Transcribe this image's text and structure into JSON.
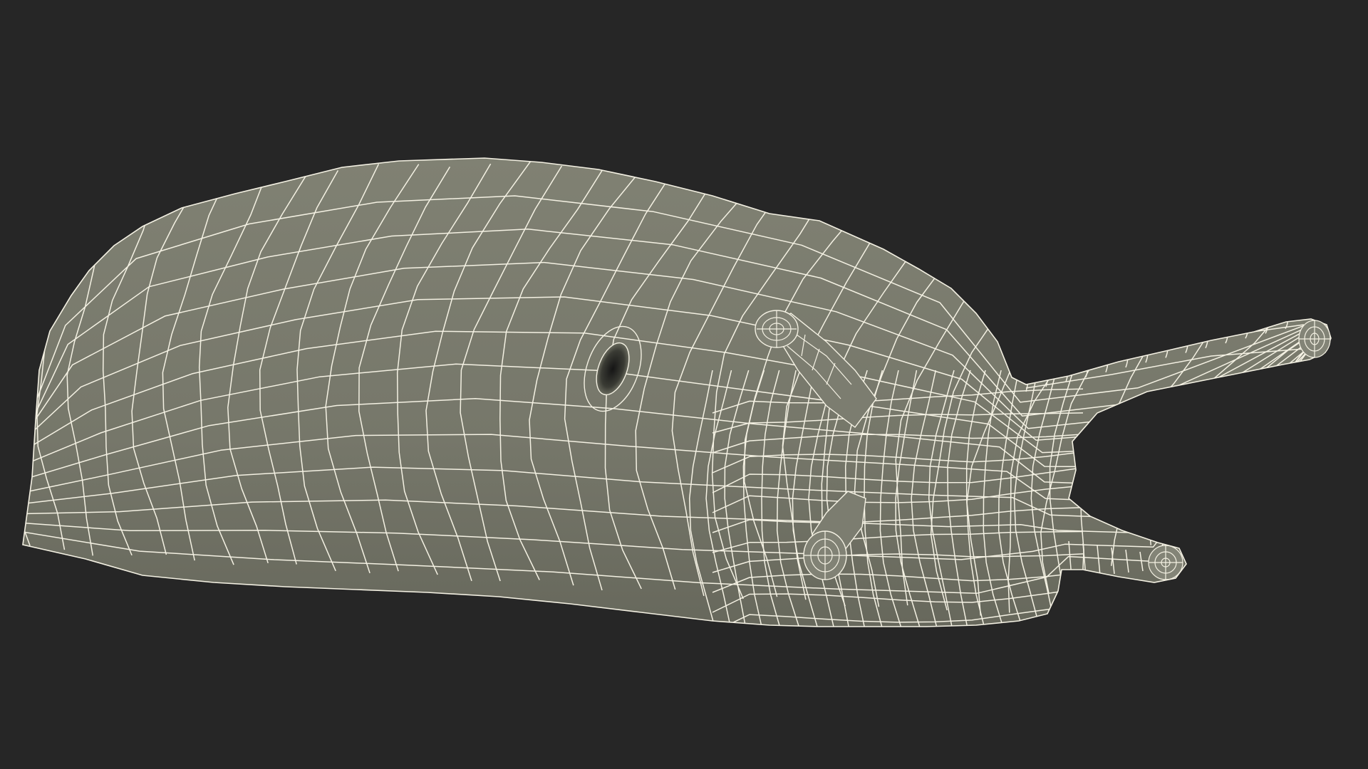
{
  "scene": {
    "subject": "slug-wireframe-model",
    "background_color": "#262626",
    "surface_color": "#7a7b6d",
    "surface_shadow_color": "#5f6055",
    "wire_color": "#f4f1e3"
  }
}
